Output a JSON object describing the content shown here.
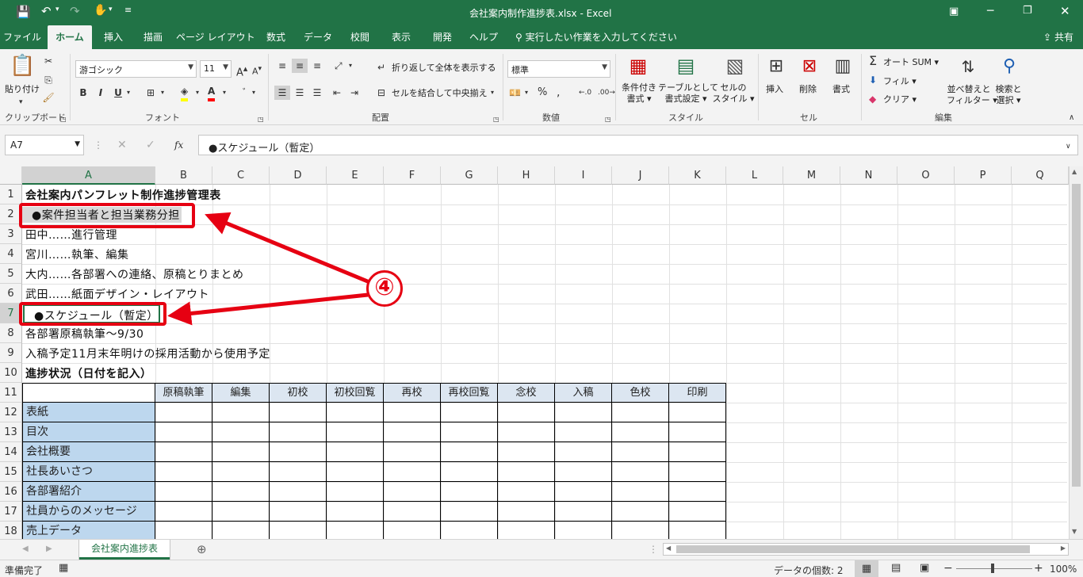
{
  "title_bar": {
    "filename": "会社案内制作進捗表.xlsx",
    "separator": "-",
    "app": "Excel"
  },
  "ribbon_tabs": [
    "ファイル",
    "ホーム",
    "挿入",
    "描画",
    "ページ レイアウト",
    "数式",
    "データ",
    "校閲",
    "表示",
    "開発",
    "ヘルプ"
  ],
  "active_tab": "ホーム",
  "tell_me": "実行したい作業を入力してください",
  "share": "共有",
  "clipboard": {
    "paste": "貼り付け",
    "label": "クリップボード"
  },
  "font": {
    "name": "游ゴシック",
    "size": "11",
    "label": "フォント",
    "bold": "B",
    "italic": "I",
    "underline": "U"
  },
  "alignment": {
    "wrap": "折り返して全体を表示する",
    "merge": "セルを結合して中央揃え",
    "label": "配置"
  },
  "number": {
    "format": "標準",
    "label": "数値",
    "percent": "%"
  },
  "styles": {
    "conditional": "条件付き\n書式",
    "conditional_1": "条件付き",
    "conditional_2": "書式",
    "table_1": "テーブルとして",
    "table_2": "書式設定",
    "cell_1": "セルの",
    "cell_2": "スタイル",
    "label": "スタイル"
  },
  "cells": {
    "insert": "挿入",
    "delete": "削除",
    "format": "書式",
    "label": "セル"
  },
  "editing": {
    "autosum": "オート SUM",
    "fill": "フィル",
    "clear": "クリア",
    "sort_1": "並べ替えと",
    "sort_2": "フィルター",
    "find_1": "検索と",
    "find_2": "選択",
    "label": "編集"
  },
  "formula_bar": {
    "name_box": "A7",
    "content": "●スケジュール（暫定）",
    "fx": "fx"
  },
  "columns": [
    "A",
    "B",
    "C",
    "D",
    "E",
    "F",
    "G",
    "H",
    "I",
    "J",
    "K",
    "L",
    "M",
    "N",
    "O",
    "P",
    "Q"
  ],
  "rows": [
    "1",
    "2",
    "3",
    "4",
    "5",
    "6",
    "7",
    "8",
    "9",
    "10",
    "11",
    "12",
    "13",
    "14",
    "15",
    "16",
    "17",
    "18"
  ],
  "cells_text": {
    "r1": "会社案内パンフレット制作進捗管理表",
    "r2": "●案件担当者と担当業務分担",
    "r3": "田中……進行管理",
    "r4": "宮川……執筆、編集",
    "r5": "大内……各部署への連絡、原稿とりまとめ",
    "r6": "武田……紙面デザイン・レイアウト",
    "r7": "●スケジュール（暫定）",
    "r8": "各部署原稿執筆～9/30",
    "r9": "入稿予定11月末年明けの採用活動から使用予定",
    "r10": "進捗状況（日付を記入）"
  },
  "table_headers": [
    "原稿執筆",
    "編集",
    "初校",
    "初校回覧",
    "再校",
    "再校回覧",
    "念校",
    "入稿",
    "色校",
    "印刷"
  ],
  "table_rows": [
    "表紙",
    "目次",
    "会社概要",
    "社長あいさつ",
    "各部署紹介",
    "社員からのメッセージ",
    "売上データ"
  ],
  "callout": {
    "number": "④",
    "color": "#e60012"
  },
  "sheet_tab": "会社案内進捗表",
  "status": {
    "ready": "準備完了",
    "count": "データの個数: 2",
    "zoom": "100%"
  },
  "colors": {
    "excel_green": "#217346",
    "header_fill": "#bdd7ee"
  }
}
